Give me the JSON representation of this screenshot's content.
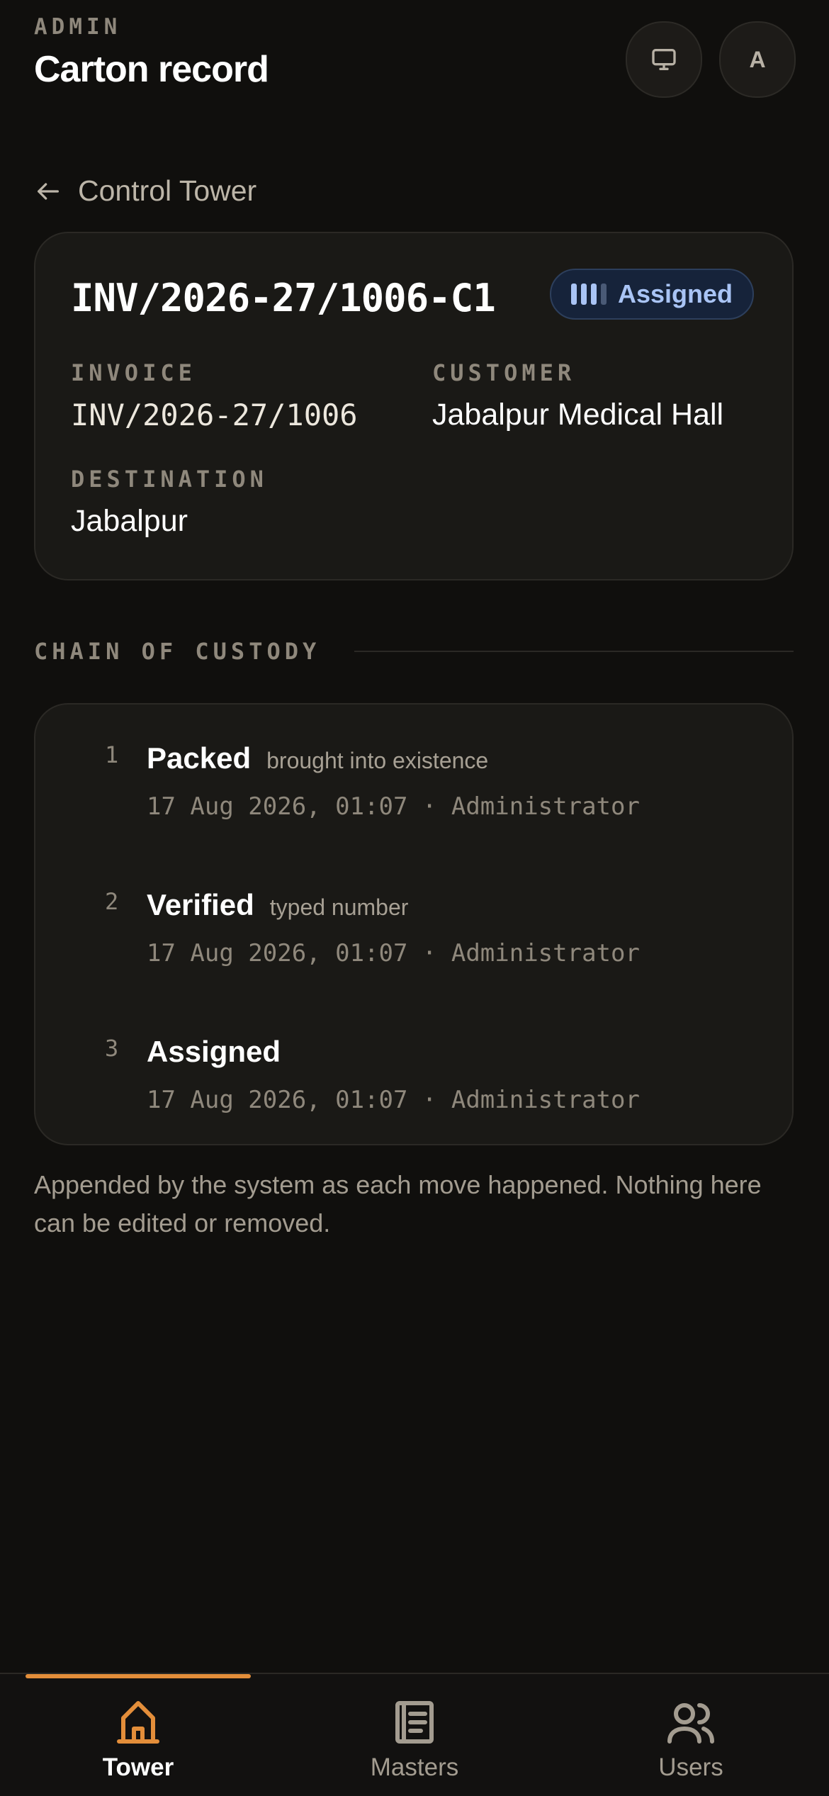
{
  "header": {
    "eyebrow": "ADMIN",
    "title": "Carton record",
    "monitor_icon": "monitor-icon",
    "avatar_initial": "A"
  },
  "back_link": {
    "label": "Control Tower",
    "icon": "arrow-left-icon"
  },
  "record": {
    "carton_id": "INV/2026-27/1006-C1",
    "status": {
      "label": "Assigned",
      "level": 3,
      "of": 4,
      "color": "#a9c4f5"
    },
    "fields": {
      "invoice": {
        "label": "INVOICE",
        "value": "INV/2026-27/1006"
      },
      "customer": {
        "label": "CUSTOMER",
        "value": "Jabalpur Medical Hall"
      },
      "destination": {
        "label": "DESTINATION",
        "value": "Jabalpur"
      }
    }
  },
  "custody": {
    "title": "CHAIN OF CUSTODY",
    "events": [
      {
        "num": "1",
        "title": "Packed",
        "note": "brought into existence",
        "meta": "17 Aug 2026, 01:07 · Administrator"
      },
      {
        "num": "2",
        "title": "Verified",
        "note": "typed number",
        "meta": "17 Aug 2026, 01:07 · Administrator"
      },
      {
        "num": "3",
        "title": "Assigned",
        "note": "",
        "meta": "17 Aug 2026, 01:07 · Administrator"
      }
    ],
    "footnote": "Appended by the system as each move happened. Nothing here can be edited or removed."
  },
  "nav": {
    "accent": "#e38e3a",
    "items": [
      {
        "label": "Tower",
        "icon": "home-icon",
        "active": true
      },
      {
        "label": "Masters",
        "icon": "document-icon",
        "active": false
      },
      {
        "label": "Users",
        "icon": "users-icon",
        "active": false
      }
    ]
  }
}
